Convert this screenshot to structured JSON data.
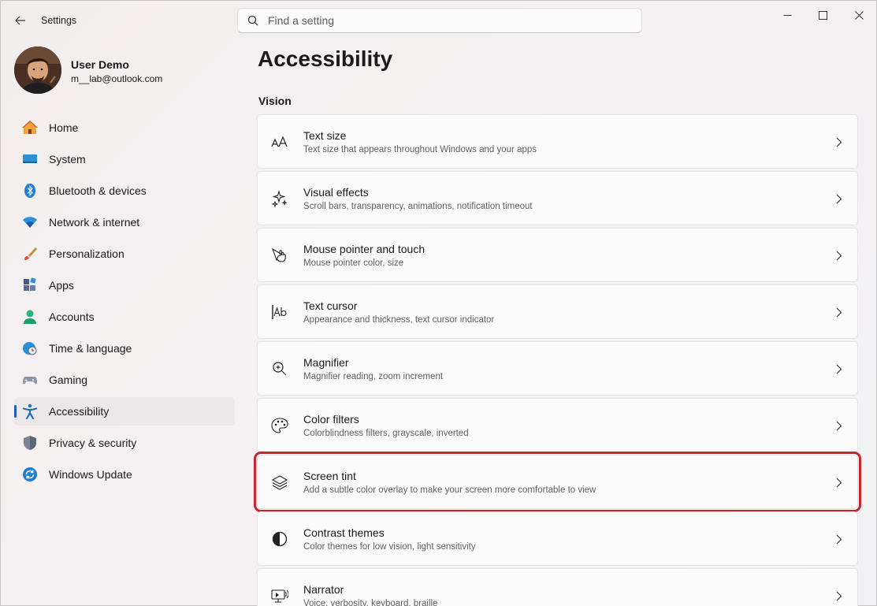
{
  "app": {
    "title": "Settings"
  },
  "search": {
    "placeholder": "Find a setting"
  },
  "user": {
    "name": "User Demo",
    "email": "m__lab@outlook.com"
  },
  "sidebar": {
    "items": [
      {
        "label": "Home",
        "icon": "home-icon",
        "active": false
      },
      {
        "label": "System",
        "icon": "system-icon",
        "active": false
      },
      {
        "label": "Bluetooth & devices",
        "icon": "bluetooth-icon",
        "active": false
      },
      {
        "label": "Network & internet",
        "icon": "wifi-icon",
        "active": false
      },
      {
        "label": "Personalization",
        "icon": "brush-icon",
        "active": false
      },
      {
        "label": "Apps",
        "icon": "apps-icon",
        "active": false
      },
      {
        "label": "Accounts",
        "icon": "accounts-icon",
        "active": false
      },
      {
        "label": "Time & language",
        "icon": "clock-globe-icon",
        "active": false
      },
      {
        "label": "Gaming",
        "icon": "gamepad-icon",
        "active": false
      },
      {
        "label": "Accessibility",
        "icon": "accessibility-icon",
        "active": true
      },
      {
        "label": "Privacy & security",
        "icon": "shield-icon",
        "active": false
      },
      {
        "label": "Windows Update",
        "icon": "update-icon",
        "active": false
      }
    ]
  },
  "main": {
    "title": "Accessibility",
    "section": "Vision",
    "cards": [
      {
        "title": "Text size",
        "desc": "Text size that appears throughout Windows and your apps",
        "icon": "text-size-icon"
      },
      {
        "title": "Visual effects",
        "desc": "Scroll bars, transparency, animations, notification timeout",
        "icon": "sparkle-icon"
      },
      {
        "title": "Mouse pointer and touch",
        "desc": "Mouse pointer color, size",
        "icon": "pointer-icon"
      },
      {
        "title": "Text cursor",
        "desc": "Appearance and thickness, text cursor indicator",
        "icon": "text-cursor-icon"
      },
      {
        "title": "Magnifier",
        "desc": "Magnifier reading, zoom increment",
        "icon": "magnifier-icon"
      },
      {
        "title": "Color filters",
        "desc": "Colorblindness filters, grayscale, inverted",
        "icon": "palette-icon"
      },
      {
        "title": "Screen tint",
        "desc": "Add a subtle color overlay to make your screen more comfortable to view",
        "icon": "layers-icon",
        "highlighted": true
      },
      {
        "title": "Contrast themes",
        "desc": "Color themes for low vision, light sensitivity",
        "icon": "contrast-icon"
      },
      {
        "title": "Narrator",
        "desc": "Voice, verbosity, keyboard, braille",
        "icon": "narrator-icon"
      }
    ]
  },
  "colors": {
    "accent": "#1a5fb4",
    "highlight": "#c5272f"
  }
}
